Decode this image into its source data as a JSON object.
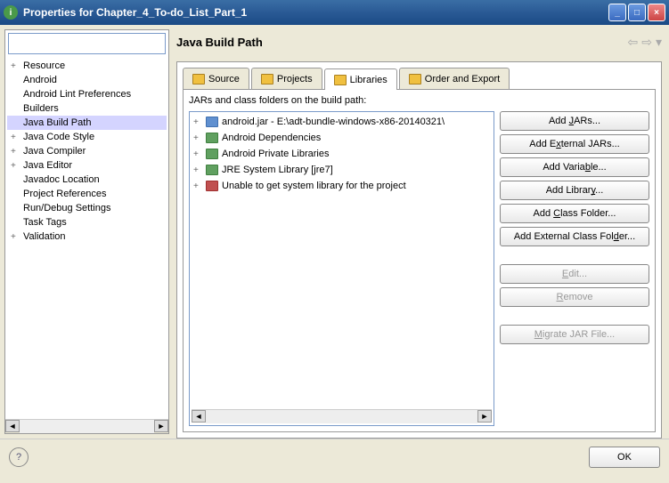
{
  "window": {
    "title": "Properties for Chapter_4_To-do_List_Part_1"
  },
  "tree": {
    "items": [
      {
        "label": "Resource",
        "expand": "+"
      },
      {
        "label": "Android",
        "expand": ""
      },
      {
        "label": "Android Lint Preferences",
        "expand": ""
      },
      {
        "label": "Builders",
        "expand": ""
      },
      {
        "label": "Java Build Path",
        "expand": "",
        "selected": true
      },
      {
        "label": "Java Code Style",
        "expand": "+"
      },
      {
        "label": "Java Compiler",
        "expand": "+"
      },
      {
        "label": "Java Editor",
        "expand": "+"
      },
      {
        "label": "Javadoc Location",
        "expand": ""
      },
      {
        "label": "Project References",
        "expand": ""
      },
      {
        "label": "Run/Debug Settings",
        "expand": ""
      },
      {
        "label": "Task Tags",
        "expand": ""
      },
      {
        "label": "Validation",
        "expand": "+"
      }
    ]
  },
  "header": {
    "title": "Java Build Path"
  },
  "tabs": {
    "source": "Source",
    "projects": "Projects",
    "libraries": "Libraries",
    "order": "Order and Export"
  },
  "content": {
    "description": "JARs and class folders on the build path:",
    "items": [
      {
        "label": "android.jar - E:\\adt-bundle-windows-x86-20140321\\",
        "icon": "jar"
      },
      {
        "label": "Android Dependencies",
        "icon": "lib"
      },
      {
        "label": "Android Private Libraries",
        "icon": "lib"
      },
      {
        "label": "JRE System Library [jre7]",
        "icon": "lib"
      },
      {
        "label": "Unable to get system library for the project",
        "icon": "err"
      }
    ]
  },
  "buttons": {
    "add_jars": "Add JARs...",
    "add_external_jars": "Add External JARs...",
    "add_variable": "Add Variable...",
    "add_library": "Add Library...",
    "add_class_folder": "Add Class Folder...",
    "add_external_class_folder": "Add External Class Folder...",
    "edit": "Edit...",
    "remove": "Remove",
    "migrate": "Migrate JAR File..."
  },
  "footer": {
    "ok": "OK"
  }
}
